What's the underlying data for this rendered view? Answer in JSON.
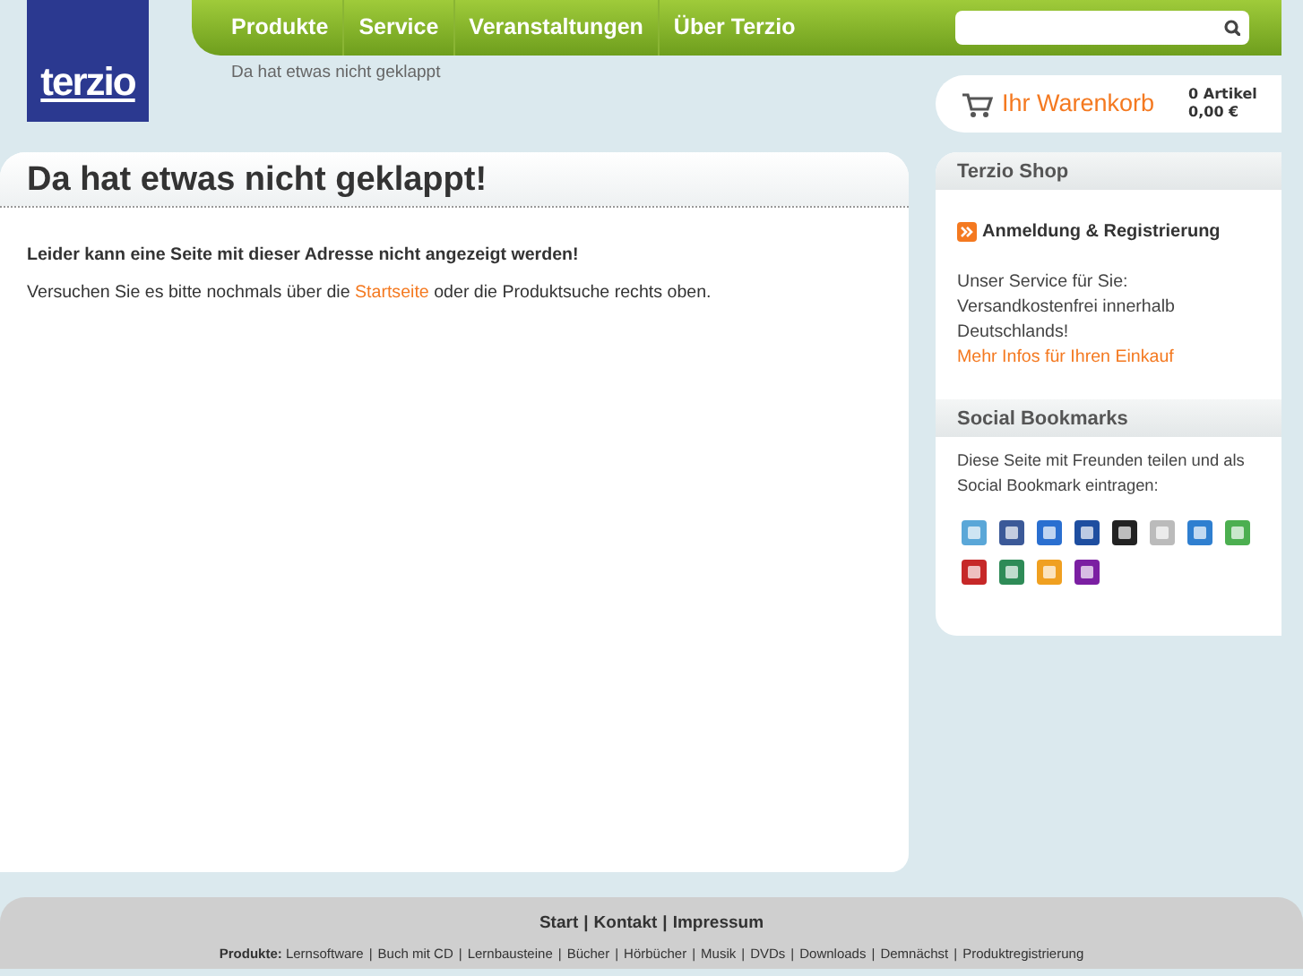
{
  "logo": {
    "text": "terzio"
  },
  "nav": [
    {
      "label": "Produkte"
    },
    {
      "label": "Service"
    },
    {
      "label": "Veranstaltungen"
    },
    {
      "label": "Über Terzio"
    }
  ],
  "breadcrumb": "Da hat etwas nicht geklappt",
  "cart": {
    "label": "Ihr Warenkorb",
    "count": "0 Artikel",
    "total": "0,00 €"
  },
  "main": {
    "title": "Da hat etwas nicht geklappt!",
    "lead": "Leider kann eine Seite mit dieser Adresse nicht angezeigt werden!",
    "text_before": "Versuchen Sie es bitte nochmals über die",
    "link": "Startseite",
    "text_after": "oder die Produktsuche rechts oben."
  },
  "sidebar": {
    "shop_title": "Terzio Shop",
    "login": "Anmeldung & Registrierung",
    "service_text": "Unser Service für Sie: Versandkostenfrei innerhalb Deutschlands!",
    "more_link": "Mehr Infos für Ihren Einkauf",
    "social_title": "Social Bookmarks",
    "social_text": "Diese Seite mit Freunden teilen und als Social Bookmark eintragen:",
    "bookmarks": [
      {
        "color": "#5aa7d8"
      },
      {
        "color": "#3b5998"
      },
      {
        "color": "#2a6fd0"
      },
      {
        "color": "#1e4ea0"
      },
      {
        "color": "#222222"
      },
      {
        "color": "#bbbbbb"
      },
      {
        "color": "#2f7fd0"
      },
      {
        "color": "#4caf50"
      },
      {
        "color": "#c62828"
      },
      {
        "color": "#2e8b57"
      },
      {
        "color": "#f0a020"
      },
      {
        "color": "#7b1fa2"
      }
    ]
  },
  "footer": {
    "separator": "|",
    "links": [
      "Start",
      "Kontakt",
      "Impressum"
    ],
    "products_label": "Produkte:",
    "products": [
      "Lernsoftware",
      "Buch mit CD",
      "Lernbausteine",
      "Bücher",
      "Hörbücher",
      "Musik",
      "DVDs",
      "Downloads",
      "Demnächst",
      "Produktregistrierung"
    ]
  }
}
